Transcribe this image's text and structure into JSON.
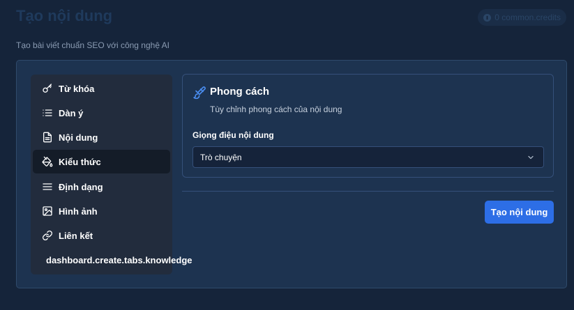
{
  "header": {
    "title": "Tạo nội dung",
    "subtitle": "Tạo bài viết chuẩn SEO với công nghệ AI",
    "credits": "0 common.credits"
  },
  "sidebar": {
    "items": [
      {
        "label": "Từ khóa",
        "icon": "key-icon"
      },
      {
        "label": "Dàn ý",
        "icon": "list-icon"
      },
      {
        "label": "Nội dung",
        "icon": "document-icon"
      },
      {
        "label": "Kiểu thức",
        "icon": "paint-bucket-icon",
        "active": true
      },
      {
        "label": "Định dạng",
        "icon": "align-icon"
      },
      {
        "label": "Hình ảnh",
        "icon": "image-icon"
      },
      {
        "label": "Liên kết",
        "icon": "link-icon"
      },
      {
        "label": "dashboard.create.tabs.knowledge"
      }
    ]
  },
  "panel": {
    "title": "Phong cách",
    "description": "Tùy chỉnh phong cách của nội dung",
    "icon": "paintbrush-icon",
    "tone_label": "Giọng điệu nội dung",
    "tone_value": "Trò chuyện"
  },
  "actions": {
    "submit_label": "Tạo nội dung"
  },
  "colors": {
    "background": "#15243a",
    "card": "#1d3350",
    "sidebar": "#222c3d",
    "active_item": "#141c28",
    "accent": "#2d6ee6",
    "brush_icon": "#4a8df0"
  }
}
